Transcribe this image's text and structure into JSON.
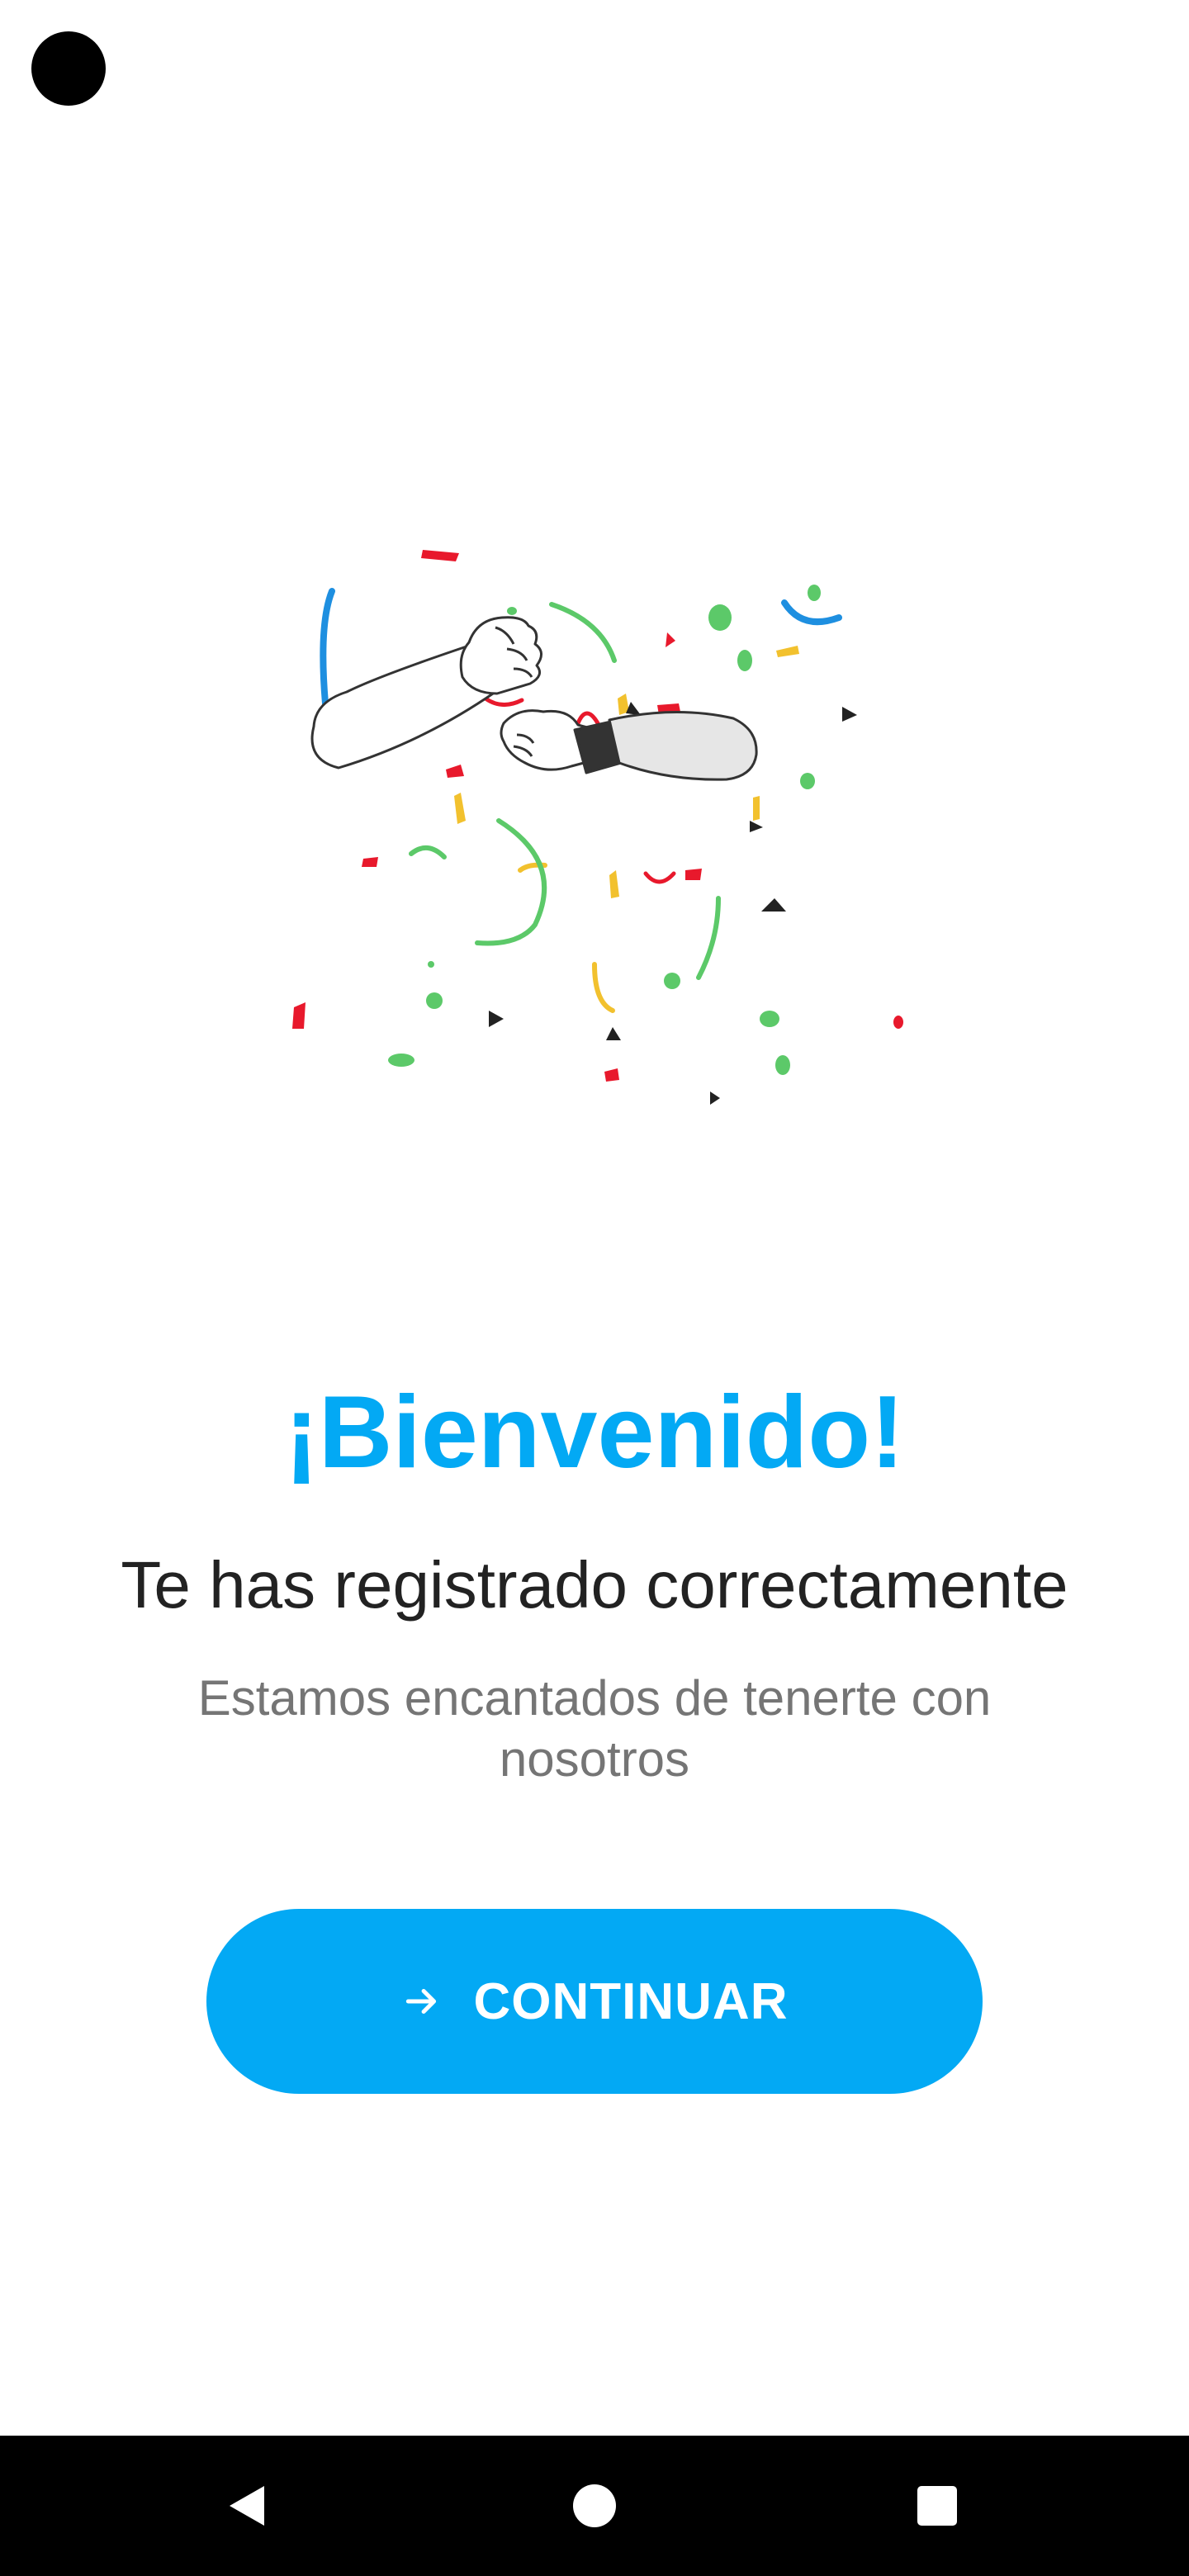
{
  "welcome": {
    "title": "¡Bienvenido!",
    "subtitle": "Te has registrado correctamente",
    "description": "Estamos encantados de tenerte con nosotros"
  },
  "continue_button": {
    "label": "CONTINUAR",
    "icon": "arrow-right-icon"
  },
  "illustration": {
    "name": "fist-bump-confetti-illustration"
  },
  "nav_bar": {
    "back_icon": "back-triangle-icon",
    "home_icon": "home-circle-icon",
    "recents_icon": "recents-square-icon"
  },
  "colors": {
    "accent": "#03a9f4",
    "title_text": "#222222",
    "secondary_text": "#757575",
    "confetti_red": "#e8192c",
    "confetti_yellow": "#f2c12e",
    "confetti_green": "#5cc969",
    "confetti_blue": "#1e8fe0"
  }
}
